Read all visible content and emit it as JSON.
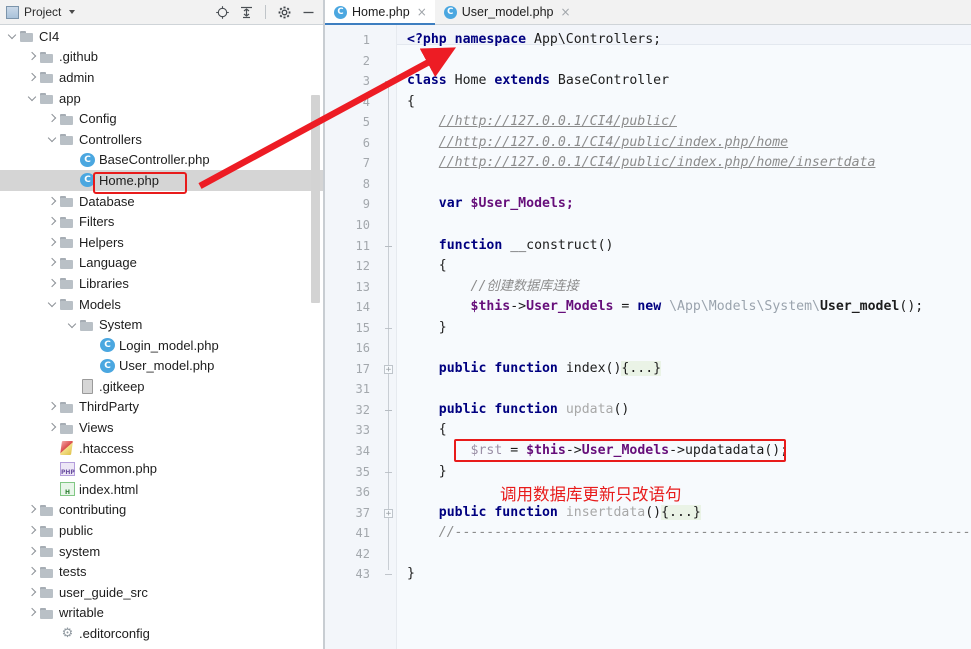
{
  "project_panel": {
    "title": "Project",
    "toolbar_icons": [
      {
        "name": "locate-icon",
        "glyph": "target"
      },
      {
        "name": "collapse-all-icon",
        "glyph": "collapse"
      },
      {
        "name": "settings-gear-icon",
        "glyph": "gear"
      },
      {
        "name": "hide-panel-icon",
        "glyph": "minus"
      }
    ],
    "tree": [
      {
        "label": "CI4",
        "indent": 0,
        "arrow": "down",
        "icon": "folder",
        "selected": false
      },
      {
        "label": ".github",
        "indent": 1,
        "arrow": "right",
        "icon": "folder",
        "selected": false
      },
      {
        "label": "admin",
        "indent": 1,
        "arrow": "right",
        "icon": "folder",
        "selected": false
      },
      {
        "label": "app",
        "indent": 1,
        "arrow": "down",
        "icon": "folder",
        "selected": false
      },
      {
        "label": "Config",
        "indent": 2,
        "arrow": "right",
        "icon": "folder",
        "selected": false
      },
      {
        "label": "Controllers",
        "indent": 2,
        "arrow": "down",
        "icon": "folder",
        "selected": false
      },
      {
        "label": "BaseController.php",
        "indent": 3,
        "arrow": "none",
        "icon": "class",
        "selected": false
      },
      {
        "label": "Home.php",
        "indent": 3,
        "arrow": "none",
        "icon": "class",
        "selected": true
      },
      {
        "label": "Database",
        "indent": 2,
        "arrow": "right",
        "icon": "folder",
        "selected": false
      },
      {
        "label": "Filters",
        "indent": 2,
        "arrow": "right",
        "icon": "folder",
        "selected": false
      },
      {
        "label": "Helpers",
        "indent": 2,
        "arrow": "right",
        "icon": "folder",
        "selected": false
      },
      {
        "label": "Language",
        "indent": 2,
        "arrow": "right",
        "icon": "folder",
        "selected": false
      },
      {
        "label": "Libraries",
        "indent": 2,
        "arrow": "right",
        "icon": "folder",
        "selected": false
      },
      {
        "label": "Models",
        "indent": 2,
        "arrow": "down",
        "icon": "folder",
        "selected": false
      },
      {
        "label": "System",
        "indent": 3,
        "arrow": "down",
        "icon": "folder",
        "selected": false
      },
      {
        "label": "Login_model.php",
        "indent": 4,
        "arrow": "none",
        "icon": "class",
        "selected": false
      },
      {
        "label": "User_model.php",
        "indent": 4,
        "arrow": "none",
        "icon": "class",
        "selected": false
      },
      {
        "label": ".gitkeep",
        "indent": 3,
        "arrow": "none",
        "icon": "gitkeep",
        "selected": false
      },
      {
        "label": "ThirdParty",
        "indent": 2,
        "arrow": "right",
        "icon": "folder",
        "selected": false
      },
      {
        "label": "Views",
        "indent": 2,
        "arrow": "right",
        "icon": "folder",
        "selected": false
      },
      {
        "label": ".htaccess",
        "indent": 2,
        "arrow": "none",
        "icon": "htaccess",
        "selected": false
      },
      {
        "label": "Common.php",
        "indent": 2,
        "arrow": "none",
        "icon": "php",
        "selected": false
      },
      {
        "label": "index.html",
        "indent": 2,
        "arrow": "none",
        "icon": "html",
        "selected": false
      },
      {
        "label": "contributing",
        "indent": 1,
        "arrow": "right",
        "icon": "folder",
        "selected": false
      },
      {
        "label": "public",
        "indent": 1,
        "arrow": "right",
        "icon": "folder",
        "selected": false
      },
      {
        "label": "system",
        "indent": 1,
        "arrow": "right",
        "icon": "folder",
        "selected": false
      },
      {
        "label": "tests",
        "indent": 1,
        "arrow": "right",
        "icon": "folder",
        "selected": false
      },
      {
        "label": "user_guide_src",
        "indent": 1,
        "arrow": "right",
        "icon": "folder",
        "selected": false
      },
      {
        "label": "writable",
        "indent": 1,
        "arrow": "right",
        "icon": "folder",
        "selected": false
      },
      {
        "label": ".editorconfig",
        "indent": 2,
        "arrow": "none",
        "icon": "editorconfig",
        "selected": false
      }
    ]
  },
  "editor": {
    "tabs": [
      {
        "label": "Home.php",
        "active": true,
        "close": "×"
      },
      {
        "label": "User_model.php",
        "active": false,
        "close": "×"
      }
    ],
    "line_numbers": [
      "1",
      "2",
      "3",
      "4",
      "5",
      "6",
      "7",
      "8",
      "9",
      "10",
      "11",
      "12",
      "13",
      "14",
      "15",
      "16",
      "17",
      "31",
      "32",
      "33",
      "34",
      "35",
      "36",
      "37",
      "41",
      "42",
      "43"
    ],
    "code_lines": [
      "<?php namespace App\\Controllers;",
      "",
      "class Home extends BaseController",
      "{",
      "    //http://127.0.0.1/CI4/public/",
      "    //http://127.0.0.1/CI4/public/index.php/home",
      "    //http://127.0.0.1/CI4/public/index.php/home/insertdata",
      "",
      "    var $User_Models;",
      "",
      "    function __construct()",
      "    {",
      "        //创建数据库连接",
      "        $this->User_Models = new \\App\\Models\\System\\User_model();",
      "    }",
      "",
      "    public function index(){...}",
      "",
      "    public function updata()",
      "    {",
      "        $rst = $this->User_Models->updatadata();",
      "    }",
      "",
      "    public function insertdata(){...}",
      "    //------------------------------------------------------------",
      "",
      "}"
    ]
  },
  "annotations": {
    "chinese_note": "调用数据库更新只改语句",
    "inline_comment_13": "//创建数据库连接",
    "highlight_color": "#e81b1b",
    "arrow_from": "Home.php tree item",
    "arrow_to": "code line 1"
  }
}
